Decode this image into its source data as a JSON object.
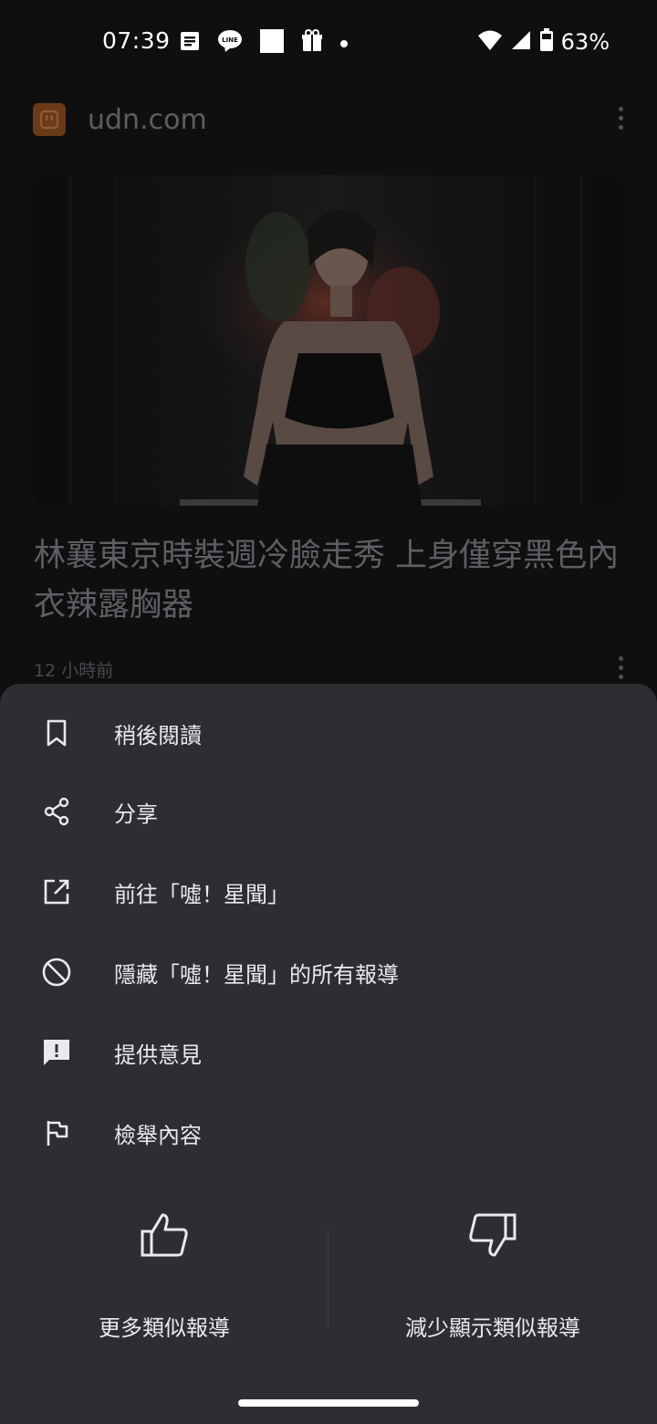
{
  "status_bar": {
    "time": "07:39",
    "notifications": [
      "news-icon",
      "line-icon",
      "square-icon",
      "gift-icon",
      "dot-icon"
    ],
    "wifi_icon": "wifi-icon",
    "signal_icon": "signal-icon",
    "battery_icon": "battery-icon",
    "battery": "63%"
  },
  "background": {
    "source_name": "udn.com",
    "headline": "林襄東京時裝週冷臉走秀 上身僅穿黑色內衣辣露胸器",
    "time_ago": "12 小時前"
  },
  "sheet": {
    "menu": [
      {
        "icon": "bookmark-icon",
        "label": "稍後閱讀"
      },
      {
        "icon": "share-icon",
        "label": "分享"
      },
      {
        "icon": "open-in-new-icon",
        "label": "前往「噓！星聞」"
      },
      {
        "icon": "block-icon",
        "label": "隱藏「噓！星聞」的所有報導"
      },
      {
        "icon": "feedback-icon",
        "label": "提供意見"
      },
      {
        "icon": "flag-icon",
        "label": "檢舉內容"
      }
    ],
    "more_like_this": "更多類似報導",
    "fewer_like_this": "減少顯示類似報導"
  },
  "colors": {
    "sheet_bg": "#2d2e32",
    "page_bg": "#0f0f10",
    "text": "#e8eaed",
    "source_logo": "#6a3a16"
  }
}
